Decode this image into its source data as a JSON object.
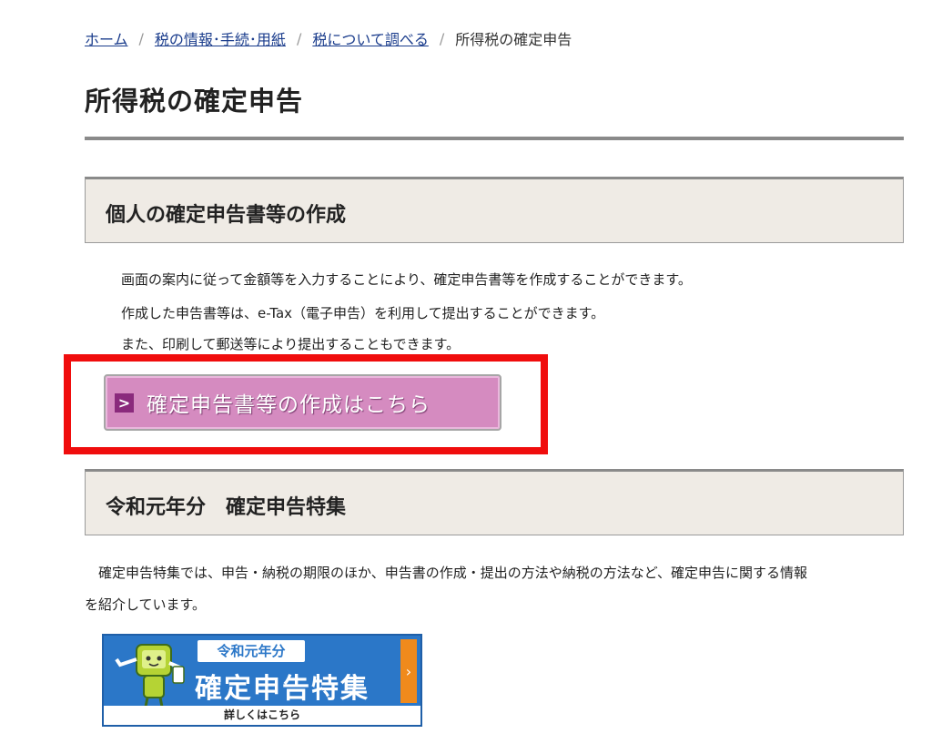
{
  "breadcrumb": {
    "items": [
      "ホーム",
      "税の情報･手続･用紙",
      "税について調べる"
    ],
    "current": "所得税の確定申告",
    "separator": "/"
  },
  "page_title": "所得税の確定申告",
  "section1": {
    "heading": "個人の確定申告書等の作成",
    "lines": [
      "画面の案内に従って金額等を入力することにより、確定申告書等を作成することができます。",
      "作成した申告書等は、e-Tax（電子申告）を利用して提出することができます。",
      "また、印刷して郵送等により提出することもできます。"
    ],
    "button_label": "確定申告書等の作成はこちら",
    "button_icon": "chevron-right-icon"
  },
  "section2": {
    "heading": "令和元年分　確定申告特集",
    "lines": [
      "　確定申告特集では、申告・納税の期限のほか、申告書の作成・提出の方法や納税の方法など、確定申告に関する情報",
      "を紹介しています。"
    ]
  },
  "banner": {
    "year_label": "令和元年分",
    "main_label": "確定申告特集",
    "detail_label": "詳しくはこちら",
    "arrow": "›"
  },
  "colors": {
    "link": "#1a3c8c",
    "highlight": "#f00d0d",
    "button_bg": "#d58bc0",
    "banner_bg": "#2b77c8",
    "banner_tab": "#f08a1c"
  }
}
